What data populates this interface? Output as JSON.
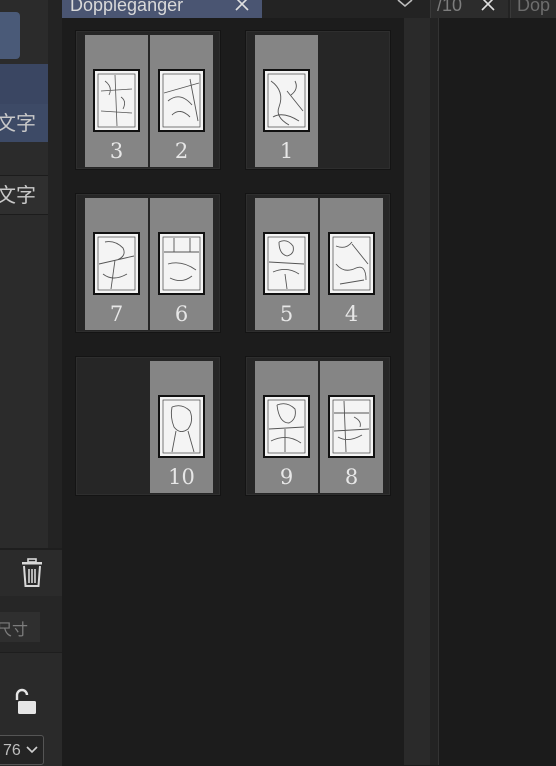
{
  "left_panel": {
    "layers": [
      {
        "label": "文字"
      },
      {
        "label": "文字"
      }
    ],
    "size_label": "尺寸",
    "zoom_value": "76"
  },
  "tabs": {
    "active": {
      "label": "Doppleganger"
    },
    "second": {
      "label": "/10"
    },
    "third": {
      "label": "Dop"
    }
  },
  "spreads": [
    {
      "pages": [
        {
          "number": "3"
        },
        {
          "number": "2"
        }
      ]
    },
    {
      "pages": [
        {
          "number": "1"
        }
      ]
    },
    {
      "pages": [
        {
          "number": "7"
        },
        {
          "number": "6"
        }
      ]
    },
    {
      "pages": [
        {
          "number": "5"
        },
        {
          "number": "4"
        }
      ]
    },
    {
      "pages": [
        {
          "number": "10"
        }
      ]
    },
    {
      "pages": [
        {
          "number": "9"
        },
        {
          "number": "8"
        }
      ]
    }
  ],
  "colors": {
    "accent": "#4a5572",
    "page_fill": "#858585"
  },
  "icons": {
    "trash": "trash-icon",
    "lock": "unlock-icon",
    "close": "close-icon",
    "chevron": "chevron-down-icon"
  }
}
